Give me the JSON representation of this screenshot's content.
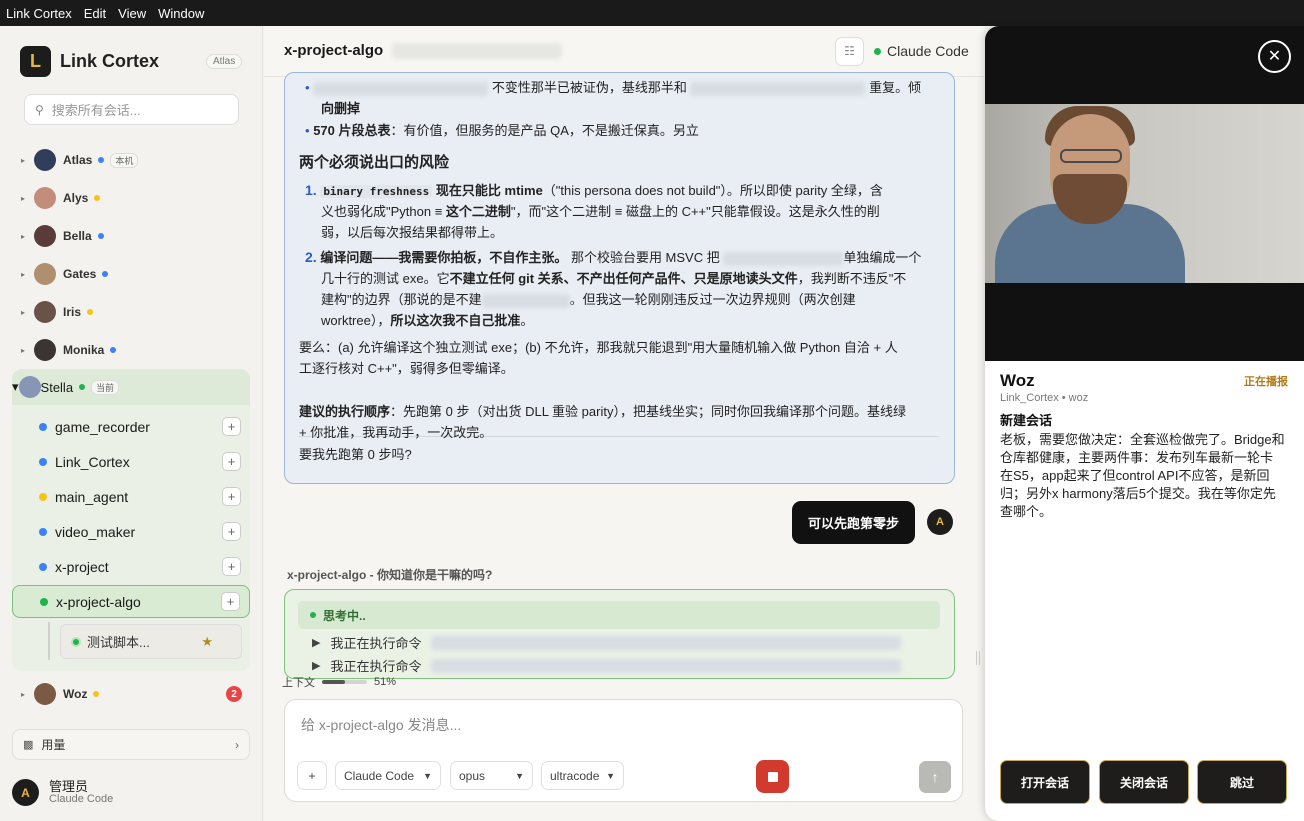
{
  "menubar": {
    "items": [
      "Link Cortex",
      "Edit",
      "View",
      "Window"
    ]
  },
  "brand": {
    "logo": "L",
    "name": "Link Cortex",
    "badge": "Atlas"
  },
  "search": {
    "placeholder": "搜索所有会话..."
  },
  "agents": [
    {
      "name": "Atlas",
      "status": "blue",
      "tag": "本机"
    },
    {
      "name": "Alys",
      "status": "yellow"
    },
    {
      "name": "Bella",
      "status": "blue"
    },
    {
      "name": "Gates",
      "status": "blue"
    },
    {
      "name": "Iris",
      "status": "yellow"
    },
    {
      "name": "Monika",
      "status": "blue"
    },
    {
      "name": "Stella",
      "status": "green",
      "tag": "当前"
    },
    {
      "name": "Woz",
      "status": "yellow",
      "count": "2"
    }
  ],
  "projects": [
    {
      "name": "game_recorder",
      "color": "#3b82f6"
    },
    {
      "name": "Link_Cortex",
      "color": "#3b82f6"
    },
    {
      "name": "main_agent",
      "color": "#f6c417"
    },
    {
      "name": "video_maker",
      "color": "#3b82f6"
    },
    {
      "name": "x-project",
      "color": "#3b82f6"
    },
    {
      "name": "x-project-algo",
      "color": "#22b24c"
    }
  ],
  "subtask": {
    "label": "测试脚本..."
  },
  "usage": {
    "label": "用量"
  },
  "user": {
    "avatar": "A",
    "name": "管理员",
    "sub": "Claude Code"
  },
  "main": {
    "title": "x-project-algo",
    "engine": "Claude Code",
    "msg": {
      "l1": "不变性那半已被证伪，基线那半和",
      "l1b": "重复。倾",
      "l2": "向删掉",
      "b2_bold": "570 片段总表",
      "b2_rest": "：有价值，但服务的是产品 QA，不是搬迁保真。另立",
      "heading": "两个必须说出口的风险",
      "i1_num": "1.",
      "i1_code": "binary freshness",
      "i1_bold": " 现在只能比 mtime",
      "i1_rest": "（\"this persona does not build\"）。所以即使 parity 全绿，含",
      "i1_l2a": "义也弱化成\"Python ≡ ",
      "i1_l2b": "这个二进制",
      "i1_l2c": "\"，而\"这个二进制 ≡ 磁盘上的 C++\"只能靠假设。这是永久性的削",
      "i1_l3": "弱，以后每次报结果都得带上。",
      "i2_num": "2.",
      "i2_bold": "编译问题——我需要你拍板，不自作主张。",
      "i2_rest": " 那个校验台要用 MSVC 把",
      "i2_rest2": "单独编成一个",
      "i2_l2a": "几十行的测试 exe。它",
      "i2_l2b": "不建立任何 git 关系、不产出任何产品件、只是原地读头文件",
      "i2_l2c": "，我判断不违反\"不",
      "i2_l3a": "建构\"的边界（那说的是不建",
      "i2_l3b": "。但我这一轮刚刚违反过一次边界规则（两次创建",
      "i2_l4a": "worktree），",
      "i2_l4b": "所以这次我不自己批准",
      "i2_l4c": "。",
      "p1": "要么：(a) 允许编译这个独立测试 exe；(b) 不允许，那我就只能退到\"用大量随机输入做 Python 自洽 + 人",
      "p2": "工逐行核对 C++\"，弱得多但零编译。",
      "order_bold": "建议的执行顺序",
      "order_rest": "：先跑第 0 步（对出货 DLL 重验 parity），把基线坐实；同时你回我编译那个问题。基线绿",
      "order_l2": "+ 你批准，我再动手，一次改完。",
      "ask": "要我先跑第 0 步吗?"
    },
    "user_msg": "可以先跑第零步",
    "user_avatar": "A",
    "reply_label": "x-project-algo - 你知道你是干嘛的吗?",
    "thinking": "思考中..",
    "exec": [
      "我正在执行命令",
      "我正在执行命令"
    ],
    "context_label": "上下文",
    "context_pct": "51%",
    "context_value": 0.51,
    "composer": {
      "placeholder": "给 x-project-algo 发消息...",
      "plus": "+",
      "engine": "Claude Code",
      "model": "opus",
      "effort": "ultracode",
      "send": "↑"
    }
  },
  "panel": {
    "close": "✕",
    "name": "Woz",
    "status": "正在播报",
    "sub": "Link_Cortex • woz",
    "title": "新建会话",
    "body": "老板，需要您做决定：全套巡检做完了。Bridge和仓库都健康，主要两件事：发布列车最新一轮卡在S5，app起来了但control API不应答，是新回归；另外x harmony落后5个提交。我在等你定先查哪个。",
    "buttons": [
      "打开会话",
      "关闭会话",
      "跳过"
    ]
  }
}
